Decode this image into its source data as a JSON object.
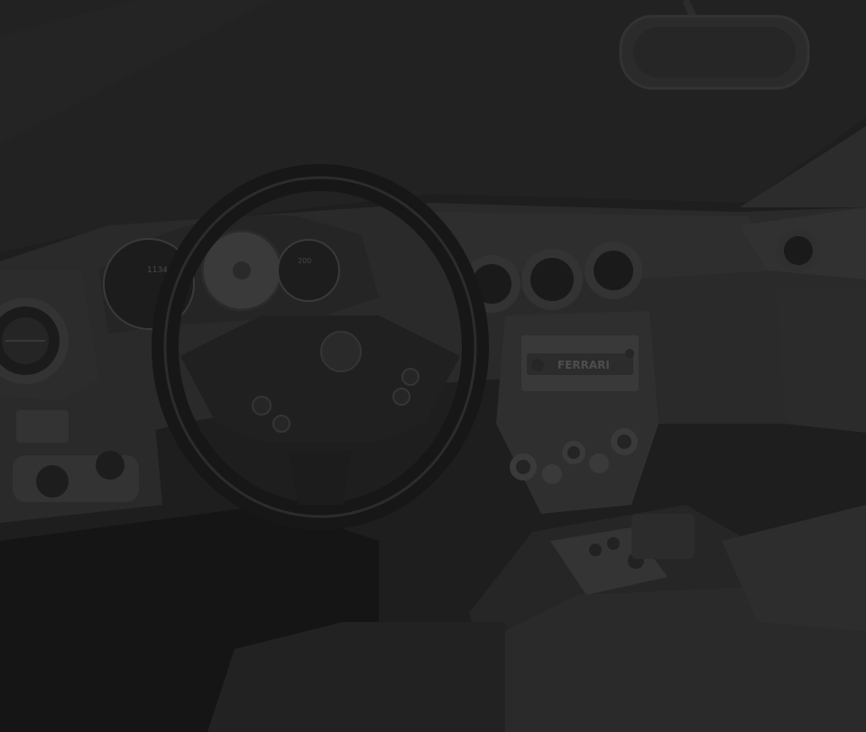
{
  "photo": {
    "subject": "car-interior-dashboard",
    "colors": {
      "background": "#1e1e1e",
      "windshield": "#212121",
      "dashboard": "#2a2a2a",
      "panel": "#303030",
      "highlight": "#3a3a3a",
      "wheel": "#181818",
      "wheel_edge": "#2e2e2e",
      "seat": "#262626",
      "floor": "#141414"
    },
    "gauges": {
      "left_readout": "1134",
      "speed_readout": "200"
    },
    "radio": {
      "brand_text": "FERRARI"
    }
  }
}
